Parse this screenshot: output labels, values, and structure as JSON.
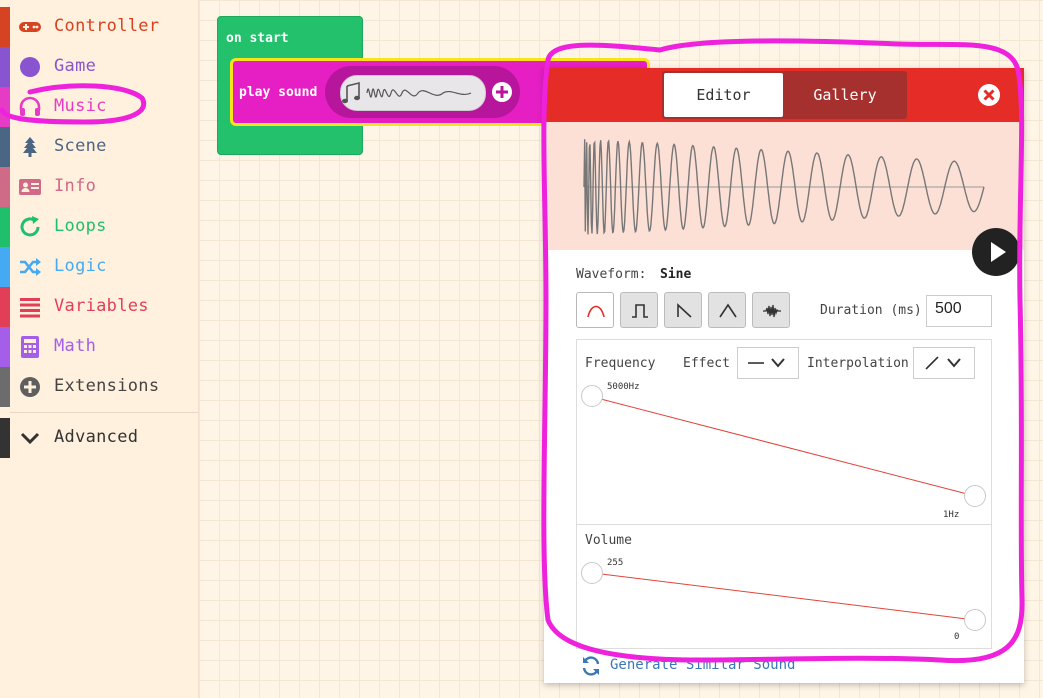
{
  "toolbox": {
    "categories": [
      {
        "label": "Controller",
        "color": "#d54322",
        "icon": "gamepad-icon"
      },
      {
        "label": "Game",
        "color": "#8854d0",
        "icon": "circle-icon"
      },
      {
        "label": "Music",
        "color": "#e63cc5",
        "icon": "headphones-icon"
      },
      {
        "label": "Scene",
        "color": "#4b6584",
        "icon": "tree-icon"
      },
      {
        "label": "Info",
        "color": "#cf6a87",
        "icon": "id-card-icon"
      },
      {
        "label": "Loops",
        "color": "#20bf6b",
        "icon": "refresh-icon"
      },
      {
        "label": "Logic",
        "color": "#45aaf2",
        "icon": "shuffle-icon"
      },
      {
        "label": "Variables",
        "color": "#e23e57",
        "icon": "list-icon"
      },
      {
        "label": "Math",
        "color": "#a55eea",
        "icon": "calculator-icon"
      },
      {
        "label": "Extensions",
        "color": "#6c6c6c",
        "icon": "plus-circle-icon"
      }
    ],
    "advanced": {
      "label": "Advanced",
      "color": "#333333",
      "icon": "chevron-down-icon"
    }
  },
  "blocks": {
    "on_start": "on start",
    "play_sound": "play sound"
  },
  "sound_editor": {
    "tabs": {
      "editor": "Editor",
      "gallery": "Gallery",
      "active": "Editor"
    },
    "waveform_label": "Waveform:",
    "waveform_value": "Sine",
    "waveforms": [
      "sine",
      "square",
      "sawtooth",
      "triangle",
      "noise"
    ],
    "duration_label": "Duration (ms)",
    "duration_value": "500",
    "frequency_label": "Frequency",
    "effect_label": "Effect",
    "interpolation_label": "Interpolation",
    "frequency_start": "5000Hz",
    "frequency_end": "1Hz",
    "volume_label": "Volume",
    "volume_start": "255",
    "volume_end": "0",
    "generate_label": "Generate Similar Sound"
  },
  "colors": {
    "header": "#e52c27",
    "preview_bg": "#fce0d5",
    "block_green": "#23c16b",
    "block_magenta": "#e61fc5",
    "annotation": "#ee22dd"
  }
}
